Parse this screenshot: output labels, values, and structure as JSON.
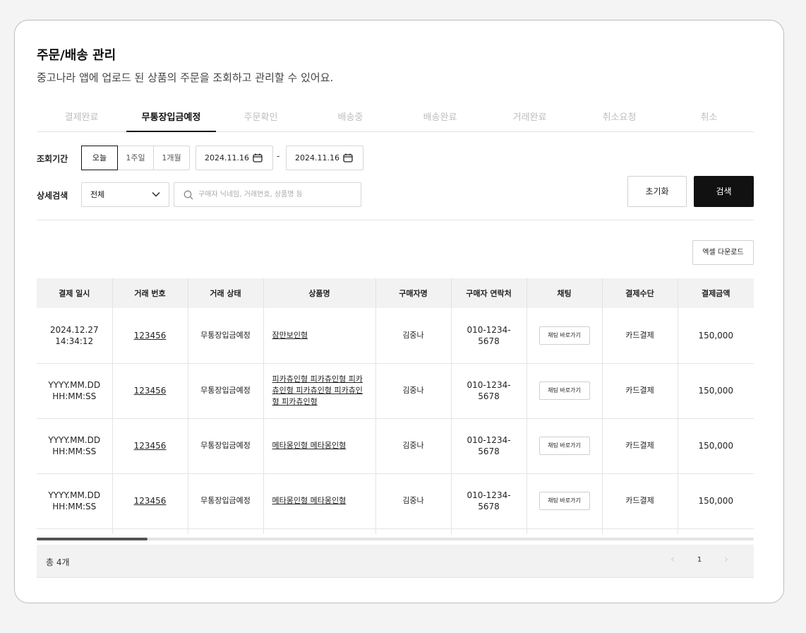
{
  "header": {
    "title": "주문/배송 관리",
    "subtitle": "중고나라 앱에 업로드 된 상품의 주문을 조회하고 관리할 수 있어요."
  },
  "tabs": [
    {
      "label": "결제완료",
      "active": false
    },
    {
      "label": "무통장입금예정",
      "active": true
    },
    {
      "label": "주문확인",
      "active": false
    },
    {
      "label": "배송중",
      "active": false
    },
    {
      "label": "배송완료",
      "active": false
    },
    {
      "label": "거래완료",
      "active": false
    },
    {
      "label": "취소요청",
      "active": false
    },
    {
      "label": "취소",
      "active": false
    }
  ],
  "filters": {
    "period_label": "조회기간",
    "period_options": [
      "오늘",
      "1주일",
      "1개월"
    ],
    "start_date": "2024.11.16",
    "end_date": "2024.11.16",
    "date_separator": "-",
    "detail_label": "상세검색",
    "detail_select_value": "전체",
    "search_placeholder": "구매자 닉네임, 거래번호, 상품명 등",
    "reset_label": "초기화",
    "search_label": "검색"
  },
  "excel_label": "엑셀 다운로드",
  "table": {
    "headers": [
      "결제 일시",
      "거래 번호",
      "거래 상태",
      "상품명",
      "구매자명",
      "구매자 연락처",
      "채팅",
      "결제수단",
      "결제금액"
    ],
    "rows": [
      {
        "date": "2024.12.27",
        "time": "14:34:12",
        "order_no": "123456",
        "status": "무통장입금예정",
        "product": "잠만보인형",
        "buyer": "김중나",
        "phone1": "010-1234-",
        "phone2": "5678",
        "chat": "채팅 바로가기",
        "method": "카드결제",
        "amount": "150,000"
      },
      {
        "date": "YYYY.MM.DD",
        "time": "HH:MM:SS",
        "order_no": "123456",
        "status": "무통장입금예정",
        "product": "피카츄인형 피카츄인형 피카츄인형 피카츄인형 피카츄인형 피카츄인형",
        "buyer": "김중나",
        "phone1": "010-1234-",
        "phone2": "5678",
        "chat": "채팅 바로가기",
        "method": "카드결제",
        "amount": "150,000"
      },
      {
        "date": "YYYY.MM.DD",
        "time": "HH:MM:SS",
        "order_no": "123456",
        "status": "무통장입금예정",
        "product": "메타몽인형 메타몽인형",
        "buyer": "김중나",
        "phone1": "010-1234-",
        "phone2": "5678",
        "chat": "채팅 바로가기",
        "method": "카드결제",
        "amount": "150,000"
      },
      {
        "date": "YYYY.MM.DD",
        "time": "HH:MM:SS",
        "order_no": "123456",
        "status": "무통장입금예정",
        "product": "메타몽인형 메타몽인형",
        "buyer": "김중나",
        "phone1": "010-1234-",
        "phone2": "5678",
        "chat": "채팅 바로가기",
        "method": "카드결제",
        "amount": "150,000"
      }
    ]
  },
  "footer": {
    "total": "총 4개",
    "current_page": "1",
    "prev_icon": "chevron-left-icon",
    "next_icon": "chevron-right-icon"
  },
  "colors": {
    "accent": "#111111",
    "inactive_tab": "#bdbdbd",
    "table_header_bg": "#f2f2f3"
  }
}
